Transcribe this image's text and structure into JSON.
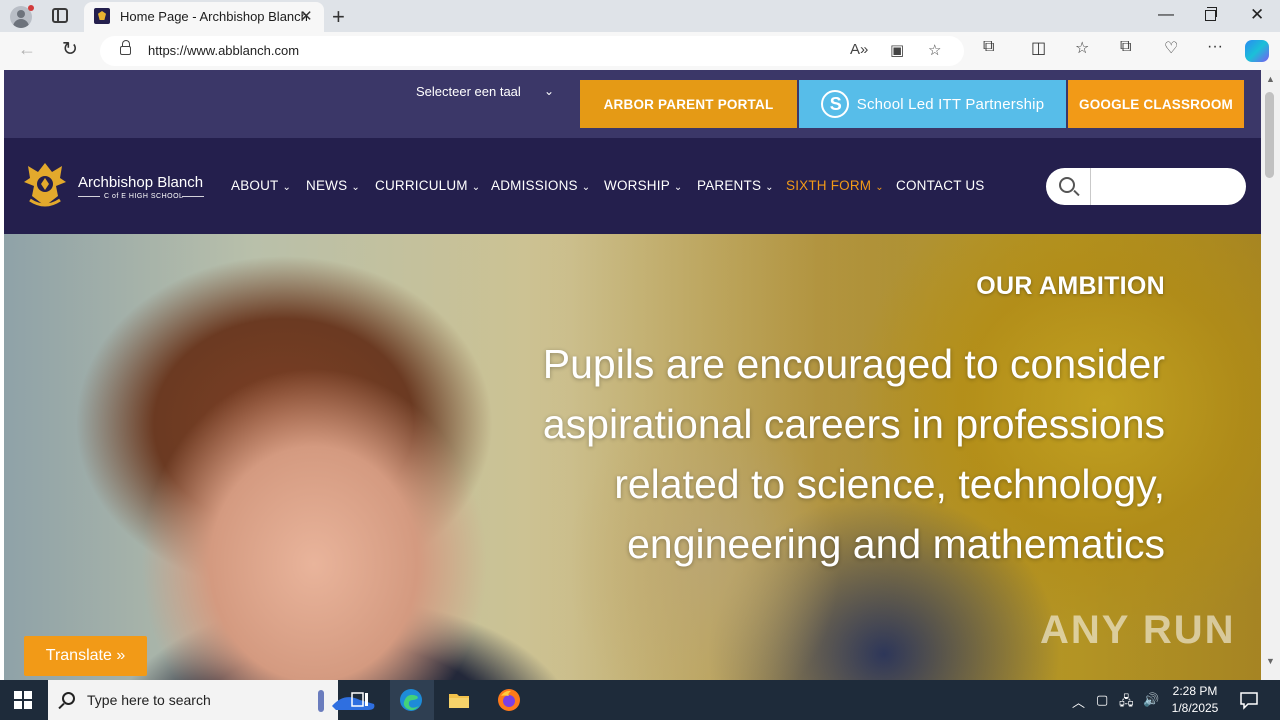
{
  "browser": {
    "tab_title": "Home Page - Archbishop Blanch",
    "url": "https://www.abblanch.com"
  },
  "page": {
    "language_select": "Selecteer een taal",
    "top_buttons": {
      "arbor": "ARBOR PARENT PORTAL",
      "itt": "School Led ITT Partnership",
      "google": "GOOGLE CLASSROOM"
    },
    "logo": {
      "name": "Archbishop Blanch",
      "sub": "C of E HIGH SCHOOL"
    },
    "menu": [
      {
        "label": "ABOUT"
      },
      {
        "label": "NEWS"
      },
      {
        "label": "CURRICULUM"
      },
      {
        "label": "ADMISSIONS"
      },
      {
        "label": "WORSHIP"
      },
      {
        "label": "PARENTS"
      },
      {
        "label": "SIXTH FORM"
      },
      {
        "label": "CONTACT US"
      }
    ],
    "search": {
      "value": ""
    },
    "hero": {
      "kicker": "OUR AMBITION",
      "text": "Pupils are encouraged to consider aspirational careers in professions related to science, technology, engineering and mathematics"
    },
    "translate_button": "Translate »",
    "watermark": "ANY RUN"
  },
  "taskbar": {
    "search_placeholder": "Type here to search",
    "time": "2:28 PM",
    "date": "1/8/2025"
  },
  "colors": {
    "topbar": "#3b3768",
    "navbar": "#241f4d",
    "accent_orange": "#f29a17",
    "itt_blue": "#57bde9"
  }
}
